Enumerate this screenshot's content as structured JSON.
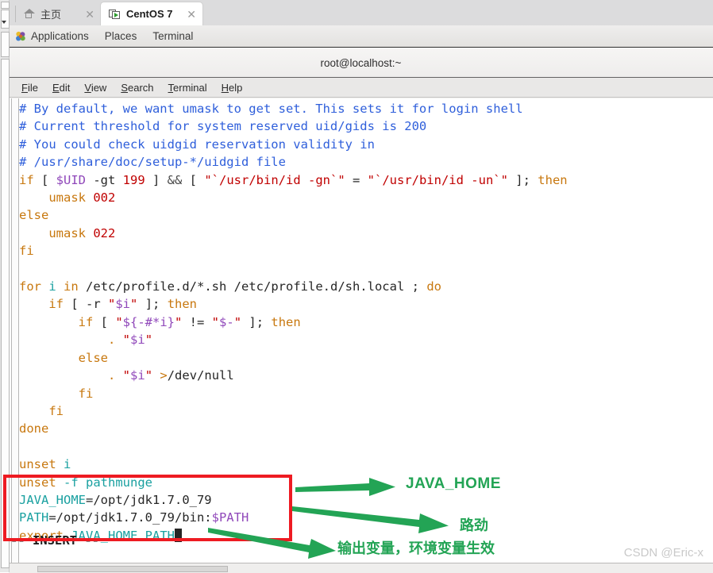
{
  "browser": {
    "tabs": [
      {
        "label": "主页",
        "icon": "home-icon",
        "active": false,
        "close_label": "✕"
      },
      {
        "label": "CentOS 7",
        "icon": "virtual-machine-icon",
        "active": true,
        "close_label": "✕"
      }
    ]
  },
  "desktop_panel": {
    "menus": [
      "Applications",
      "Places",
      "Terminal"
    ]
  },
  "terminal": {
    "title": "root@localhost:~",
    "menus": [
      {
        "accel": "F",
        "rest": "ile"
      },
      {
        "accel": "E",
        "rest": "dit"
      },
      {
        "accel": "V",
        "rest": "iew"
      },
      {
        "accel": "S",
        "rest": "earch"
      },
      {
        "accel": "T",
        "rest": "erminal"
      },
      {
        "accel": "H",
        "rest": "elp"
      }
    ],
    "status_line": "-- INSERT --"
  },
  "editor": {
    "lines": [
      "# By default, we want umask to get set. This sets it for login shell",
      "# Current threshold for system reserved uid/gids is 200",
      "# You could check uidgid reservation validity in",
      "# /usr/share/doc/setup-*/uidgid file",
      "if [ $UID -gt 199 ] && [ \"`/usr/bin/id -gn`\" = \"`/usr/bin/id -un`\" ]; then",
      "    umask 002",
      "else",
      "    umask 022",
      "fi",
      "",
      "for i in /etc/profile.d/*.sh /etc/profile.d/sh.local ; do",
      "    if [ -r \"$i\" ]; then",
      "        if [ \"${-#*i}\" != \"$-\" ]; then",
      "            . \"$i\"",
      "        else",
      "            . \"$i\" >/dev/null",
      "        fi",
      "    fi",
      "done",
      "",
      "unset i",
      "unset -f pathmunge",
      "JAVA_HOME=/opt/jdk1.7.0_79",
      "PATH=/opt/jdk1.7.0_79/bin:$PATH",
      "export JAVA_HOME PATH"
    ],
    "cursor_after": "export JAVA_HOME PATH"
  },
  "annotations": {
    "highlight_box_color": "#ee1b22",
    "arrow_color": "#23a455",
    "labels": [
      "JAVA_HOME",
      "路劲",
      "输出变量，环境变量生效"
    ]
  },
  "watermark": "CSDN @Eric-x",
  "colors": {
    "comment": "#2f5fdb",
    "keyword": "#c8780f",
    "variable": "#9048ba",
    "number": "#c00000",
    "string": "#c00000",
    "identifier": "#19a0a0",
    "foreground": "#262626",
    "background": "#ffffff"
  }
}
